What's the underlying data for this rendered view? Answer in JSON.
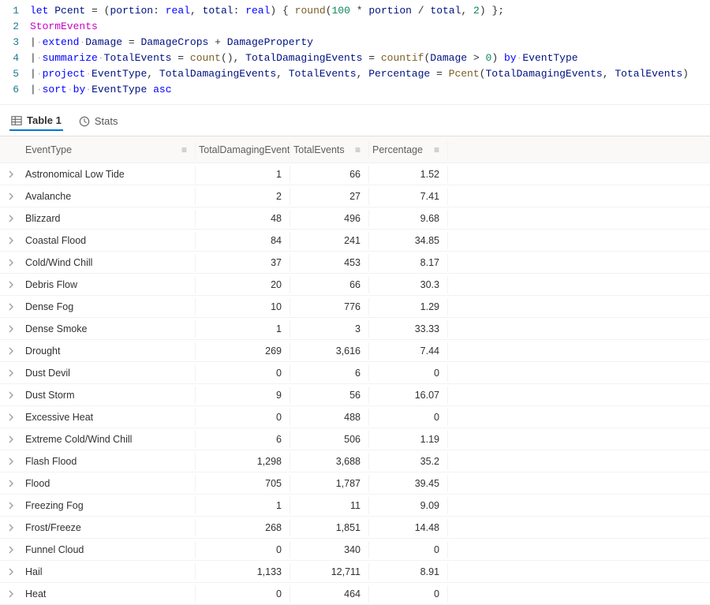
{
  "editor": {
    "lines": [
      {
        "num": "1",
        "tokens": [
          {
            "t": "let",
            "c": "tok-kw"
          },
          {
            "t": " "
          },
          {
            "t": "Pcent",
            "c": "tok-id"
          },
          {
            "t": " "
          },
          {
            "t": "=",
            "c": "tok-punc"
          },
          {
            "t": " "
          },
          {
            "t": "(",
            "c": "tok-punc"
          },
          {
            "t": "portion",
            "c": "tok-id"
          },
          {
            "t": ":",
            "c": "tok-punc"
          },
          {
            "t": " "
          },
          {
            "t": "real",
            "c": "tok-kw"
          },
          {
            "t": ",",
            "c": "tok-punc"
          },
          {
            "t": " "
          },
          {
            "t": "total",
            "c": "tok-id"
          },
          {
            "t": ":",
            "c": "tok-punc"
          },
          {
            "t": " "
          },
          {
            "t": "real",
            "c": "tok-kw"
          },
          {
            "t": ")",
            "c": "tok-punc"
          },
          {
            "t": " "
          },
          {
            "t": "{",
            "c": "tok-punc"
          },
          {
            "t": " "
          },
          {
            "t": "round",
            "c": "tok-fn"
          },
          {
            "t": "(",
            "c": "tok-punc"
          },
          {
            "t": "100",
            "c": "tok-num"
          },
          {
            "t": " "
          },
          {
            "t": "*",
            "c": "tok-punc"
          },
          {
            "t": " "
          },
          {
            "t": "portion",
            "c": "tok-id"
          },
          {
            "t": " "
          },
          {
            "t": "/",
            "c": "tok-punc"
          },
          {
            "t": " "
          },
          {
            "t": "total",
            "c": "tok-id"
          },
          {
            "t": ",",
            "c": "tok-punc"
          },
          {
            "t": " "
          },
          {
            "t": "2",
            "c": "tok-num"
          },
          {
            "t": ")",
            "c": "tok-punc"
          },
          {
            "t": " "
          },
          {
            "t": "}",
            "c": "tok-punc"
          },
          {
            "t": ";",
            "c": "tok-punc"
          }
        ]
      },
      {
        "num": "2",
        "tokens": [
          {
            "t": "StormEvents",
            "c": "tok-tbl"
          }
        ]
      },
      {
        "num": "3",
        "tokens": [
          {
            "t": "|",
            "c": "tok-pipe"
          },
          {
            "t": "·",
            "c": "tok-dot"
          },
          {
            "t": "extend",
            "c": "tok-kw"
          },
          {
            "t": "·",
            "c": "tok-dot"
          },
          {
            "t": "Damage",
            "c": "tok-id"
          },
          {
            "t": " "
          },
          {
            "t": "=",
            "c": "tok-punc"
          },
          {
            "t": " "
          },
          {
            "t": "DamageCrops",
            "c": "tok-id"
          },
          {
            "t": " "
          },
          {
            "t": "+",
            "c": "tok-punc"
          },
          {
            "t": " "
          },
          {
            "t": "DamageProperty",
            "c": "tok-id"
          }
        ]
      },
      {
        "num": "4",
        "tokens": [
          {
            "t": "|",
            "c": "tok-pipe"
          },
          {
            "t": "·",
            "c": "tok-dot"
          },
          {
            "t": "summarize",
            "c": "tok-kw"
          },
          {
            "t": "·",
            "c": "tok-dot"
          },
          {
            "t": "TotalEvents",
            "c": "tok-id"
          },
          {
            "t": " "
          },
          {
            "t": "=",
            "c": "tok-punc"
          },
          {
            "t": " "
          },
          {
            "t": "count",
            "c": "tok-fn"
          },
          {
            "t": "()",
            "c": "tok-punc"
          },
          {
            "t": ",",
            "c": "tok-punc"
          },
          {
            "t": " "
          },
          {
            "t": "TotalDamagingEvents",
            "c": "tok-id"
          },
          {
            "t": " "
          },
          {
            "t": "=",
            "c": "tok-punc"
          },
          {
            "t": " "
          },
          {
            "t": "countif",
            "c": "tok-fn"
          },
          {
            "t": "(",
            "c": "tok-punc"
          },
          {
            "t": "Damage",
            "c": "tok-id"
          },
          {
            "t": " "
          },
          {
            "t": ">",
            "c": "tok-punc"
          },
          {
            "t": " "
          },
          {
            "t": "0",
            "c": "tok-num"
          },
          {
            "t": ")",
            "c": "tok-punc"
          },
          {
            "t": " "
          },
          {
            "t": "by",
            "c": "tok-kw"
          },
          {
            "t": "·",
            "c": "tok-dot"
          },
          {
            "t": "EventType",
            "c": "tok-id"
          }
        ]
      },
      {
        "num": "5",
        "tokens": [
          {
            "t": "|",
            "c": "tok-pipe"
          },
          {
            "t": "·",
            "c": "tok-dot"
          },
          {
            "t": "project",
            "c": "tok-kw"
          },
          {
            "t": "·",
            "c": "tok-dot"
          },
          {
            "t": "EventType",
            "c": "tok-id"
          },
          {
            "t": ",",
            "c": "tok-punc"
          },
          {
            "t": " "
          },
          {
            "t": "TotalDamagingEvents",
            "c": "tok-id"
          },
          {
            "t": ",",
            "c": "tok-punc"
          },
          {
            "t": " "
          },
          {
            "t": "TotalEvents",
            "c": "tok-id"
          },
          {
            "t": ",",
            "c": "tok-punc"
          },
          {
            "t": " "
          },
          {
            "t": "Percentage",
            "c": "tok-id"
          },
          {
            "t": " "
          },
          {
            "t": "=",
            "c": "tok-punc"
          },
          {
            "t": " "
          },
          {
            "t": "Pcent",
            "c": "tok-fn"
          },
          {
            "t": "(",
            "c": "tok-punc"
          },
          {
            "t": "TotalDamagingEvents",
            "c": "tok-id"
          },
          {
            "t": ",",
            "c": "tok-punc"
          },
          {
            "t": " "
          },
          {
            "t": "TotalEvents",
            "c": "tok-id"
          },
          {
            "t": ")",
            "c": "tok-punc"
          }
        ]
      },
      {
        "num": "6",
        "tokens": [
          {
            "t": "|",
            "c": "tok-pipe"
          },
          {
            "t": "·",
            "c": "tok-dot"
          },
          {
            "t": "sort",
            "c": "tok-kw"
          },
          {
            "t": "·",
            "c": "tok-dot"
          },
          {
            "t": "by",
            "c": "tok-kw"
          },
          {
            "t": "·",
            "c": "tok-dot"
          },
          {
            "t": "EventType",
            "c": "tok-id"
          },
          {
            "t": " "
          },
          {
            "t": "asc",
            "c": "tok-kw"
          }
        ]
      }
    ]
  },
  "tabs": {
    "table_label": "Table 1",
    "stats_label": "Stats"
  },
  "grid": {
    "columns": [
      {
        "key": "EventType",
        "label": "EventType",
        "cls": "col-eventtype",
        "num": false
      },
      {
        "key": "TotalDamagingEvents",
        "label": "TotalDamagingEvents",
        "cls": "col-damaging",
        "num": true
      },
      {
        "key": "TotalEvents",
        "label": "TotalEvents",
        "cls": "col-total",
        "num": true
      },
      {
        "key": "Percentage",
        "label": "Percentage",
        "cls": "col-percent",
        "num": true
      }
    ],
    "rows": [
      {
        "EventType": "Astronomical Low Tide",
        "TotalDamagingEvents": "1",
        "TotalEvents": "66",
        "Percentage": "1.52"
      },
      {
        "EventType": "Avalanche",
        "TotalDamagingEvents": "2",
        "TotalEvents": "27",
        "Percentage": "7.41"
      },
      {
        "EventType": "Blizzard",
        "TotalDamagingEvents": "48",
        "TotalEvents": "496",
        "Percentage": "9.68"
      },
      {
        "EventType": "Coastal Flood",
        "TotalDamagingEvents": "84",
        "TotalEvents": "241",
        "Percentage": "34.85"
      },
      {
        "EventType": "Cold/Wind Chill",
        "TotalDamagingEvents": "37",
        "TotalEvents": "453",
        "Percentage": "8.17"
      },
      {
        "EventType": "Debris Flow",
        "TotalDamagingEvents": "20",
        "TotalEvents": "66",
        "Percentage": "30.3"
      },
      {
        "EventType": "Dense Fog",
        "TotalDamagingEvents": "10",
        "TotalEvents": "776",
        "Percentage": "1.29"
      },
      {
        "EventType": "Dense Smoke",
        "TotalDamagingEvents": "1",
        "TotalEvents": "3",
        "Percentage": "33.33"
      },
      {
        "EventType": "Drought",
        "TotalDamagingEvents": "269",
        "TotalEvents": "3,616",
        "Percentage": "7.44"
      },
      {
        "EventType": "Dust Devil",
        "TotalDamagingEvents": "0",
        "TotalEvents": "6",
        "Percentage": "0"
      },
      {
        "EventType": "Dust Storm",
        "TotalDamagingEvents": "9",
        "TotalEvents": "56",
        "Percentage": "16.07"
      },
      {
        "EventType": "Excessive Heat",
        "TotalDamagingEvents": "0",
        "TotalEvents": "488",
        "Percentage": "0"
      },
      {
        "EventType": "Extreme Cold/Wind Chill",
        "TotalDamagingEvents": "6",
        "TotalEvents": "506",
        "Percentage": "1.19"
      },
      {
        "EventType": "Flash Flood",
        "TotalDamagingEvents": "1,298",
        "TotalEvents": "3,688",
        "Percentage": "35.2"
      },
      {
        "EventType": "Flood",
        "TotalDamagingEvents": "705",
        "TotalEvents": "1,787",
        "Percentage": "39.45"
      },
      {
        "EventType": "Freezing Fog",
        "TotalDamagingEvents": "1",
        "TotalEvents": "11",
        "Percentage": "9.09"
      },
      {
        "EventType": "Frost/Freeze",
        "TotalDamagingEvents": "268",
        "TotalEvents": "1,851",
        "Percentage": "14.48"
      },
      {
        "EventType": "Funnel Cloud",
        "TotalDamagingEvents": "0",
        "TotalEvents": "340",
        "Percentage": "0"
      },
      {
        "EventType": "Hail",
        "TotalDamagingEvents": "1,133",
        "TotalEvents": "12,711",
        "Percentage": "8.91"
      },
      {
        "EventType": "Heat",
        "TotalDamagingEvents": "0",
        "TotalEvents": "464",
        "Percentage": "0"
      }
    ]
  },
  "chart_data": {
    "type": "table",
    "columns": [
      "EventType",
      "TotalDamagingEvents",
      "TotalEvents",
      "Percentage"
    ],
    "rows": [
      [
        "Astronomical Low Tide",
        1,
        66,
        1.52
      ],
      [
        "Avalanche",
        2,
        27,
        7.41
      ],
      [
        "Blizzard",
        48,
        496,
        9.68
      ],
      [
        "Coastal Flood",
        84,
        241,
        34.85
      ],
      [
        "Cold/Wind Chill",
        37,
        453,
        8.17
      ],
      [
        "Debris Flow",
        20,
        66,
        30.3
      ],
      [
        "Dense Fog",
        10,
        776,
        1.29
      ],
      [
        "Dense Smoke",
        1,
        3,
        33.33
      ],
      [
        "Drought",
        269,
        3616,
        7.44
      ],
      [
        "Dust Devil",
        0,
        6,
        0
      ],
      [
        "Dust Storm",
        9,
        56,
        16.07
      ],
      [
        "Excessive Heat",
        0,
        488,
        0
      ],
      [
        "Extreme Cold/Wind Chill",
        6,
        506,
        1.19
      ],
      [
        "Flash Flood",
        1298,
        3688,
        35.2
      ],
      [
        "Flood",
        705,
        1787,
        39.45
      ],
      [
        "Freezing Fog",
        1,
        11,
        9.09
      ],
      [
        "Frost/Freeze",
        268,
        1851,
        14.48
      ],
      [
        "Funnel Cloud",
        0,
        340,
        0
      ],
      [
        "Hail",
        1133,
        12711,
        8.91
      ],
      [
        "Heat",
        0,
        464,
        0
      ]
    ]
  }
}
